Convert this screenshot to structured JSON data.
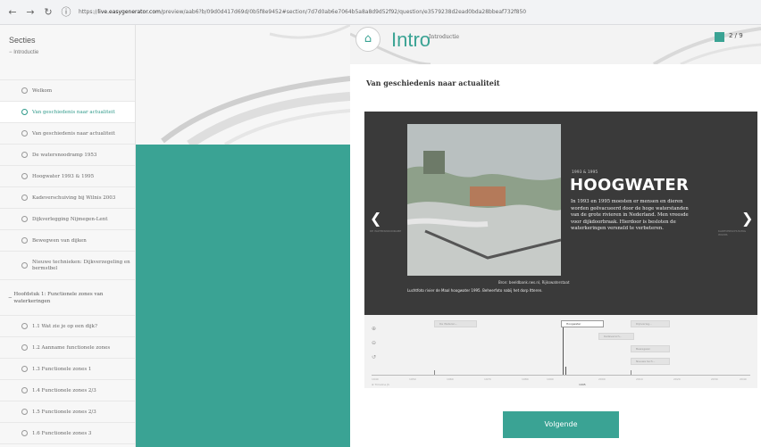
{
  "browser": {
    "back_icon": "←",
    "forward_icon": "→",
    "reload_icon": "↻",
    "info_icon": "ⓘ",
    "url_scheme": "https://",
    "url_host": "live.easygenerator.com",
    "url_path": "/preview/aab6?b/09d0d417d69d/0b5f8e9452#section/7d7d0ab6e7064b5a8a8d9d52f92/question/e3579238d2ead0bda28bbeaf732f850"
  },
  "sidebar": {
    "title": "Secties",
    "section": "Introductie",
    "section_toggle": "−",
    "items": [
      "Welkom",
      "Van geschiedenis naar actualiteit",
      "Van geschiedenis naar actualiteit",
      "De watersnoodramp 1953",
      "Hoogwater 1993 & 1995",
      "Kadeverschuiving bij Wilnis 2003",
      "Dijkverlegging Nijmegen-Lent",
      "Bewegwen van dijken",
      "Nieuwe technieken: Dijkverzegeling en bermstbel"
    ],
    "chapter_toggle": "−",
    "chapter": "Hoofdstuk 1: Functionele zones van waterkeringen",
    "chapter_items": [
      "1.1 Wat zie je op een dijk?",
      "1.2 Aanname functionele zones",
      "1.3 Functionele zones 1",
      "1.4 Functionele zones 2/3",
      "1.5 Functionele zones 2/3",
      "1.6 Functionele zones 3"
    ],
    "collapse_icon": "‹"
  },
  "header": {
    "home_icon": "⌂",
    "title": "Intro",
    "subtitle": "Introductie",
    "page": "2 / 9"
  },
  "content": {
    "title": "Van geschiedenis naar actualiteit"
  },
  "slide": {
    "date": "1993 & 1995",
    "title": "HOOGWATER",
    "body": "In 1993 en 1995 moesten er mensen en dieren worden geëvacueerd door de hoge waterstanden van de grote rivieren in Nederland. Men vreesde voor dijkdoorbraak. Hierdoor is besloten de waterkeringen versneld te verbeteren.",
    "credit": "Bron: beeldbank.rws.nl, Rijkswaterstaat",
    "caption": "Luchtfoto rivier de Maal hoogwater 1995. Beheerfoto nabij het dorp Itteren.",
    "prev_icon": "❮",
    "next_icon": "❯",
    "prev_label": "DE WATERSNOODRAMP",
    "next_label": "KADEVERSCHUIVING WILNIS"
  },
  "timeline": {
    "zoom_in_icon": "⊕",
    "zoom_out_icon": "⊖",
    "reset_icon": "↺",
    "events": [
      "De Watersn...",
      "Hoogwater",
      "Kadeversch...",
      "Dijkverleg...",
      "Bewegwen",
      "Nieuwe tech..."
    ],
    "axis_labels": [
      "1940",
      "1950",
      "1960",
      "1970",
      "1980",
      "1990",
      "2000",
      "2010",
      "2020",
      "2030",
      "2040"
    ],
    "axis_current": "1995",
    "footer": "⊕ Timeline JS"
  },
  "next_button": "Volgende",
  "colors": {
    "accent": "#3aa394",
    "slide_bg": "#3a3a3a"
  }
}
